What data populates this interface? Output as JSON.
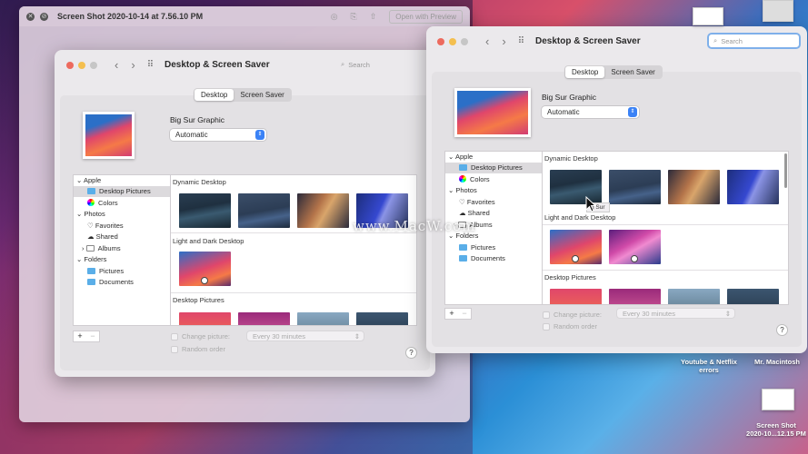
{
  "preview": {
    "title": "Screen Shot 2020-10-14 at 7.56.10 PM",
    "open_label": "Open with Preview"
  },
  "left": {
    "title": "Desktop & Screen Saver",
    "search_placeholder": "Search",
    "tab_desktop": "Desktop",
    "tab_screensaver": "Screen Saver",
    "picture_name": "Big Sur Graphic",
    "mode": "Automatic",
    "sidebar": {
      "apple": "Apple",
      "desktop_pictures": "Desktop Pictures",
      "colors": "Colors",
      "photos": "Photos",
      "favorites": "Favorites",
      "shared": "Shared",
      "albums": "Albums",
      "folders": "Folders",
      "pictures": "Pictures",
      "documents": "Documents"
    },
    "sections": {
      "dynamic": "Dynamic Desktop",
      "light_dark": "Light and Dark Desktop",
      "desktop_pictures": "Desktop Pictures"
    },
    "change_picture": "Change picture:",
    "interval": "Every 30 minutes",
    "random": "Random order",
    "help": "?"
  },
  "right": {
    "title": "Desktop & Screen Saver",
    "search_placeholder": "Search",
    "tab_desktop": "Desktop",
    "tab_screensaver": "Screen Saver",
    "picture_name": "Big Sur Graphic",
    "mode": "Automatic",
    "sidebar": {
      "apple": "Apple",
      "desktop_pictures": "Desktop Pictures",
      "colors": "Colors",
      "photos": "Photos",
      "favorites": "Favorites",
      "shared": "Shared",
      "albums": "Albums",
      "folders": "Folders",
      "pictures": "Pictures",
      "documents": "Documents"
    },
    "sections": {
      "dynamic": "Dynamic Desktop",
      "light_dark": "Light and Dark Desktop",
      "desktop_pictures": "Desktop Pictures"
    },
    "tooltip": "g Sur",
    "change_picture": "Change picture:",
    "interval": "Every 30 minutes",
    "random": "Random order",
    "help": "?"
  },
  "watermark": "www.MacW.com",
  "desktop": {
    "item1": "Youtube & Netflix errors",
    "item2": "Mr. Macintosh",
    "item3_line1": "Screen Shot",
    "item3_line2": "2020-10...12.15 PM"
  }
}
